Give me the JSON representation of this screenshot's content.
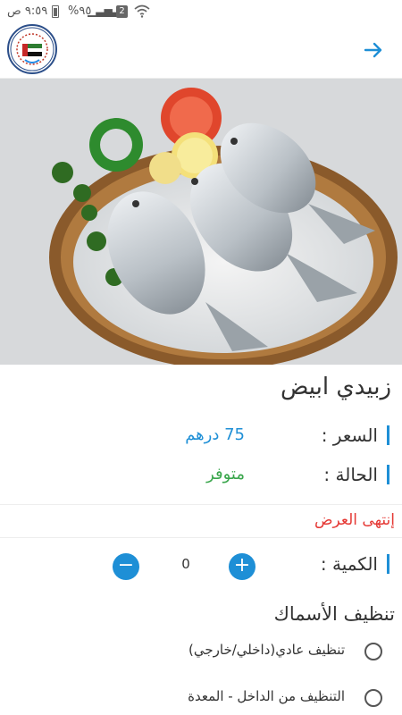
{
  "status_bar": {
    "time": "٩:٥٩ ص",
    "battery": "%٩٥",
    "sim_label": "2"
  },
  "header": {
    "back_icon": "arrow-right-icon"
  },
  "product": {
    "name": "زبيدي ابيض",
    "price_label": "السعر :",
    "price_value": "75 درهم",
    "status_label": "الحالة :",
    "status_value": "متوفر",
    "offer_text": "إنتهى العرض",
    "quantity_label": "الكمية :",
    "quantity_value": "0"
  },
  "cleaning": {
    "title": "تنظيف الأسماك",
    "options": [
      {
        "label": "تنظيف عادي(داخلي/خارجي)"
      },
      {
        "label": "التنظيف من الداخل - المعدة"
      }
    ]
  },
  "colors": {
    "accent": "#1e8fd6",
    "price": "#1e8fd6",
    "available": "#3aa64c",
    "offer": "#e53935"
  }
}
